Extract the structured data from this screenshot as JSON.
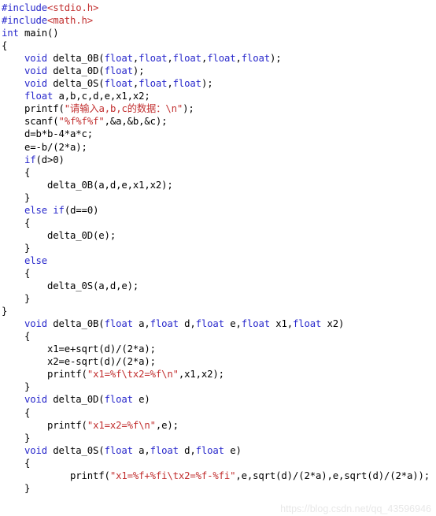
{
  "document": {
    "type": "source-code-screenshot",
    "language": "C",
    "background_color": "#ffffff",
    "colors": {
      "default_text": "#000000",
      "keyword": "#2929cc",
      "string": "#c23030",
      "preprocessor": "#2929cc",
      "header_name": "#c23030",
      "watermark": "#e8e8e8"
    },
    "watermark": "https://blog.csdn.net/qq_43596946",
    "code_lines": [
      [
        {
          "t": "#include",
          "c": "pp"
        },
        {
          "t": "<stdio.h>",
          "c": "hdr"
        }
      ],
      [
        {
          "t": "#include",
          "c": "pp"
        },
        {
          "t": "<math.h>",
          "c": "hdr"
        }
      ],
      [
        {
          "t": "int",
          "c": "kw"
        },
        {
          "t": " main()",
          "c": ""
        }
      ],
      [
        {
          "t": "{",
          "c": ""
        }
      ],
      [
        {
          "t": "    ",
          "c": ""
        },
        {
          "t": "void",
          "c": "kw"
        },
        {
          "t": " delta_0B(",
          "c": ""
        },
        {
          "t": "float",
          "c": "kw"
        },
        {
          "t": ",",
          "c": ""
        },
        {
          "t": "float",
          "c": "kw"
        },
        {
          "t": ",",
          "c": ""
        },
        {
          "t": "float",
          "c": "kw"
        },
        {
          "t": ",",
          "c": ""
        },
        {
          "t": "float",
          "c": "kw"
        },
        {
          "t": ",",
          "c": ""
        },
        {
          "t": "float",
          "c": "kw"
        },
        {
          "t": ");",
          "c": ""
        }
      ],
      [
        {
          "t": "    ",
          "c": ""
        },
        {
          "t": "void",
          "c": "kw"
        },
        {
          "t": " delta_0D(",
          "c": ""
        },
        {
          "t": "float",
          "c": "kw"
        },
        {
          "t": ");",
          "c": ""
        }
      ],
      [
        {
          "t": "    ",
          "c": ""
        },
        {
          "t": "void",
          "c": "kw"
        },
        {
          "t": " delta_0S(",
          "c": ""
        },
        {
          "t": "float",
          "c": "kw"
        },
        {
          "t": ",",
          "c": ""
        },
        {
          "t": "float",
          "c": "kw"
        },
        {
          "t": ",",
          "c": ""
        },
        {
          "t": "float",
          "c": "kw"
        },
        {
          "t": ");",
          "c": ""
        }
      ],
      [
        {
          "t": "    ",
          "c": ""
        },
        {
          "t": "float",
          "c": "kw"
        },
        {
          "t": " a,b,c,d,e,x1,x2;",
          "c": ""
        }
      ],
      [
        {
          "t": "    printf(",
          "c": ""
        },
        {
          "t": "\"请输入a,b,c的数据：\\n\"",
          "c": "str"
        },
        {
          "t": ");",
          "c": ""
        }
      ],
      [
        {
          "t": "    scanf(",
          "c": ""
        },
        {
          "t": "\"%f%f%f\"",
          "c": "str"
        },
        {
          "t": ",&a,&b,&c);",
          "c": ""
        }
      ],
      [
        {
          "t": "    d=b*b-4*a*c;",
          "c": ""
        }
      ],
      [
        {
          "t": "    e=-b/(2*a);",
          "c": ""
        }
      ],
      [
        {
          "t": "    ",
          "c": ""
        },
        {
          "t": "if",
          "c": "kw"
        },
        {
          "t": "(d>0)",
          "c": ""
        }
      ],
      [
        {
          "t": "    {",
          "c": ""
        }
      ],
      [
        {
          "t": "        delta_0B(a,d,e,x1,x2);",
          "c": ""
        }
      ],
      [
        {
          "t": "    }",
          "c": ""
        }
      ],
      [
        {
          "t": "    ",
          "c": ""
        },
        {
          "t": "else",
          "c": "kw"
        },
        {
          "t": " ",
          "c": ""
        },
        {
          "t": "if",
          "c": "kw"
        },
        {
          "t": "(d==0)",
          "c": ""
        }
      ],
      [
        {
          "t": "    {",
          "c": ""
        }
      ],
      [
        {
          "t": "        delta_0D(e);",
          "c": ""
        }
      ],
      [
        {
          "t": "    }",
          "c": ""
        }
      ],
      [
        {
          "t": "    ",
          "c": ""
        },
        {
          "t": "else",
          "c": "kw"
        }
      ],
      [
        {
          "t": "    {",
          "c": ""
        }
      ],
      [
        {
          "t": "        delta_0S(a,d,e);",
          "c": ""
        }
      ],
      [
        {
          "t": "    }",
          "c": ""
        }
      ],
      [
        {
          "t": "}",
          "c": ""
        }
      ],
      [
        {
          "t": "    ",
          "c": ""
        },
        {
          "t": "void",
          "c": "kw"
        },
        {
          "t": " delta_0B(",
          "c": ""
        },
        {
          "t": "float",
          "c": "kw"
        },
        {
          "t": " a,",
          "c": ""
        },
        {
          "t": "float",
          "c": "kw"
        },
        {
          "t": " d,",
          "c": ""
        },
        {
          "t": "float",
          "c": "kw"
        },
        {
          "t": " e,",
          "c": ""
        },
        {
          "t": "float",
          "c": "kw"
        },
        {
          "t": " x1,",
          "c": ""
        },
        {
          "t": "float",
          "c": "kw"
        },
        {
          "t": " x2)",
          "c": ""
        }
      ],
      [
        {
          "t": "    {",
          "c": ""
        }
      ],
      [
        {
          "t": "        x1=e+sqrt(d)/(2*a);",
          "c": ""
        }
      ],
      [
        {
          "t": "        x2=e-sqrt(d)/(2*a);",
          "c": ""
        }
      ],
      [
        {
          "t": "        printf(",
          "c": ""
        },
        {
          "t": "\"x1=%f\\tx2=%f\\n\"",
          "c": "str"
        },
        {
          "t": ",x1,x2);",
          "c": ""
        }
      ],
      [
        {
          "t": "    }",
          "c": ""
        }
      ],
      [
        {
          "t": "    ",
          "c": ""
        },
        {
          "t": "void",
          "c": "kw"
        },
        {
          "t": " delta_0D(",
          "c": ""
        },
        {
          "t": "float",
          "c": "kw"
        },
        {
          "t": " e)",
          "c": ""
        }
      ],
      [
        {
          "t": "    {",
          "c": ""
        }
      ],
      [
        {
          "t": "        printf(",
          "c": ""
        },
        {
          "t": "\"x1=x2=%f\\n\"",
          "c": "str"
        },
        {
          "t": ",e);",
          "c": ""
        }
      ],
      [
        {
          "t": "    }",
          "c": ""
        }
      ],
      [
        {
          "t": "    ",
          "c": ""
        },
        {
          "t": "void",
          "c": "kw"
        },
        {
          "t": " delta_0S(",
          "c": ""
        },
        {
          "t": "float",
          "c": "kw"
        },
        {
          "t": " a,",
          "c": ""
        },
        {
          "t": "float",
          "c": "kw"
        },
        {
          "t": " d,",
          "c": ""
        },
        {
          "t": "float",
          "c": "kw"
        },
        {
          "t": " e)",
          "c": ""
        }
      ],
      [
        {
          "t": "    {",
          "c": ""
        }
      ],
      [
        {
          "t": "            printf(",
          "c": ""
        },
        {
          "t": "\"x1=%f+%fi\\tx2=%f-%fi\"",
          "c": "str"
        },
        {
          "t": ",e,sqrt(d)/(2*a),e,sqrt(d)/(2*a));",
          "c": ""
        }
      ],
      [
        {
          "t": "    }",
          "c": ""
        }
      ]
    ]
  }
}
